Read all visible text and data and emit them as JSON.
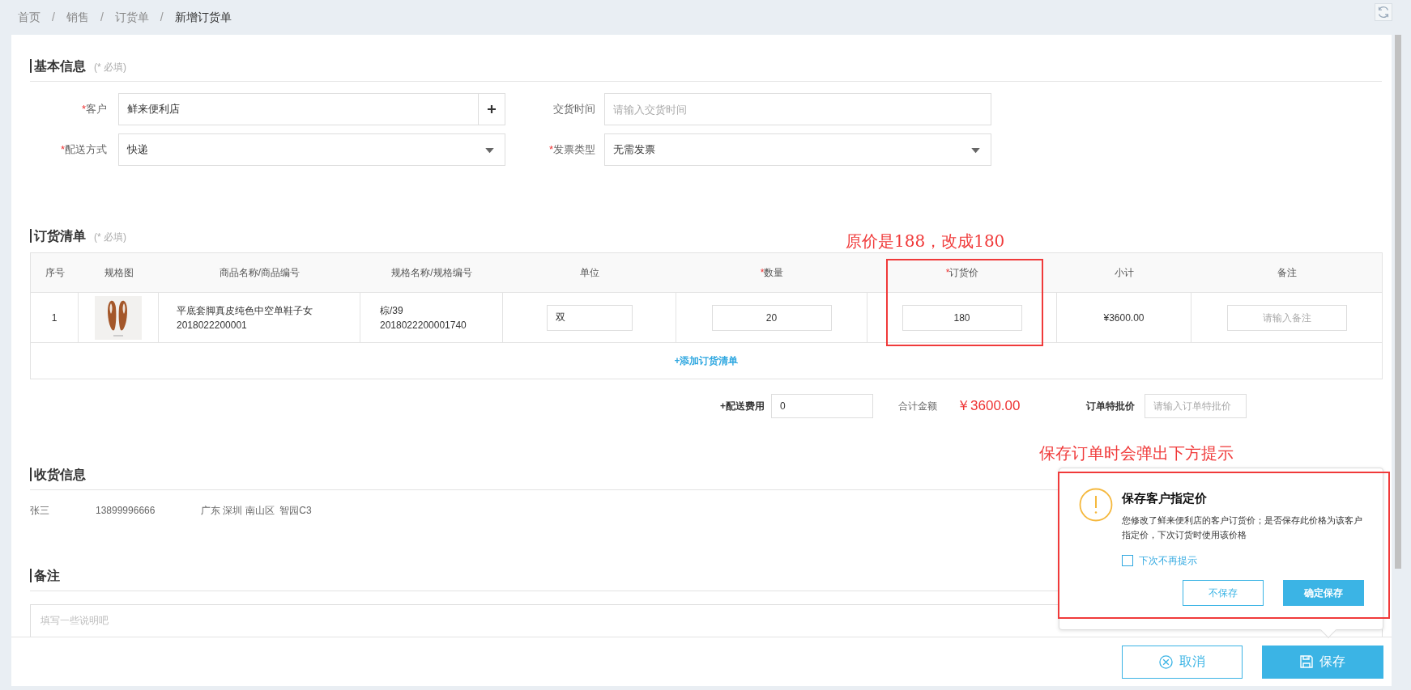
{
  "breadcrumb": [
    {
      "label": "首页",
      "current": false
    },
    {
      "label": "销售",
      "current": false
    },
    {
      "label": "订货单",
      "current": false
    },
    {
      "label": "新增订货单",
      "current": true
    }
  ],
  "breadcrumb_separator": "/",
  "basic_info": {
    "title": "基本信息",
    "note": "(* 必填)",
    "fields": [
      {
        "mark": "*",
        "label": "客户",
        "kind": "text_add",
        "value": "鲜来便利店"
      },
      {
        "label": "交货时间",
        "kind": "text",
        "placeholder": "请输入交货时间"
      },
      {
        "mark": "*",
        "label": "配送方式",
        "kind": "select",
        "value": "快递"
      },
      {
        "mark": "*",
        "label": "发票类型",
        "kind": "select",
        "value": "无需发票"
      }
    ]
  },
  "order_list": {
    "title": "订货清单",
    "note": "(* 必填)",
    "columns": [
      {
        "label": "序号"
      },
      {
        "label": "规格图"
      },
      {
        "label": "商品名称/商品编号"
      },
      {
        "label": "规格名称/规格编号"
      },
      {
        "label": "单位"
      },
      {
        "mark": "*",
        "label": "数量"
      },
      {
        "mark": "*",
        "label": "订货价"
      },
      {
        "label": "小计"
      },
      {
        "label": "备注"
      }
    ],
    "rows": [
      {
        "index": "1",
        "product_name": "平底套脚真皮纯色中空单鞋子女",
        "product_code": "2018022200001",
        "spec_name": "棕/39",
        "spec_code": "2018022200001740",
        "unit": "双",
        "quantity": "20",
        "price": "180",
        "subtotal": "¥3600.00",
        "remark_placeholder": "请输入备注"
      }
    ],
    "add_link": "+添加订货清单"
  },
  "totals": {
    "shipping_label": "+配送费用",
    "shipping_value": "0",
    "total_label": "合计金额",
    "total_value": "￥3600.00",
    "special_label": "订单特批价",
    "special_placeholder": "请输入订单特批价"
  },
  "shipping_info": {
    "title": "收货信息",
    "name": "张三",
    "phone": "13899996666",
    "address": "广东 深圳 南山区  智园C3"
  },
  "remark": {
    "title": "备注",
    "placeholder": "填写一些说明吧"
  },
  "footer_buttons": [
    {
      "label": "取消",
      "kind": "outline"
    },
    {
      "label": "保存",
      "kind": "primary"
    }
  ],
  "popup": {
    "title": "保存客户指定价",
    "message": "您修改了鲜来便利店的客户订货价；是否保存此价格为该客户指定价，下次订货时使用该价格",
    "checkbox": {
      "label": "下次不再提示",
      "checked": false
    },
    "buttons": [
      {
        "label": "不保存",
        "kind": "outline"
      },
      {
        "label": "确定保存",
        "kind": "primary"
      }
    ]
  },
  "annotations": [
    {
      "text": "原价是188，改成180"
    },
    {
      "text": "保存订单时会弹出下方提示"
    }
  ]
}
